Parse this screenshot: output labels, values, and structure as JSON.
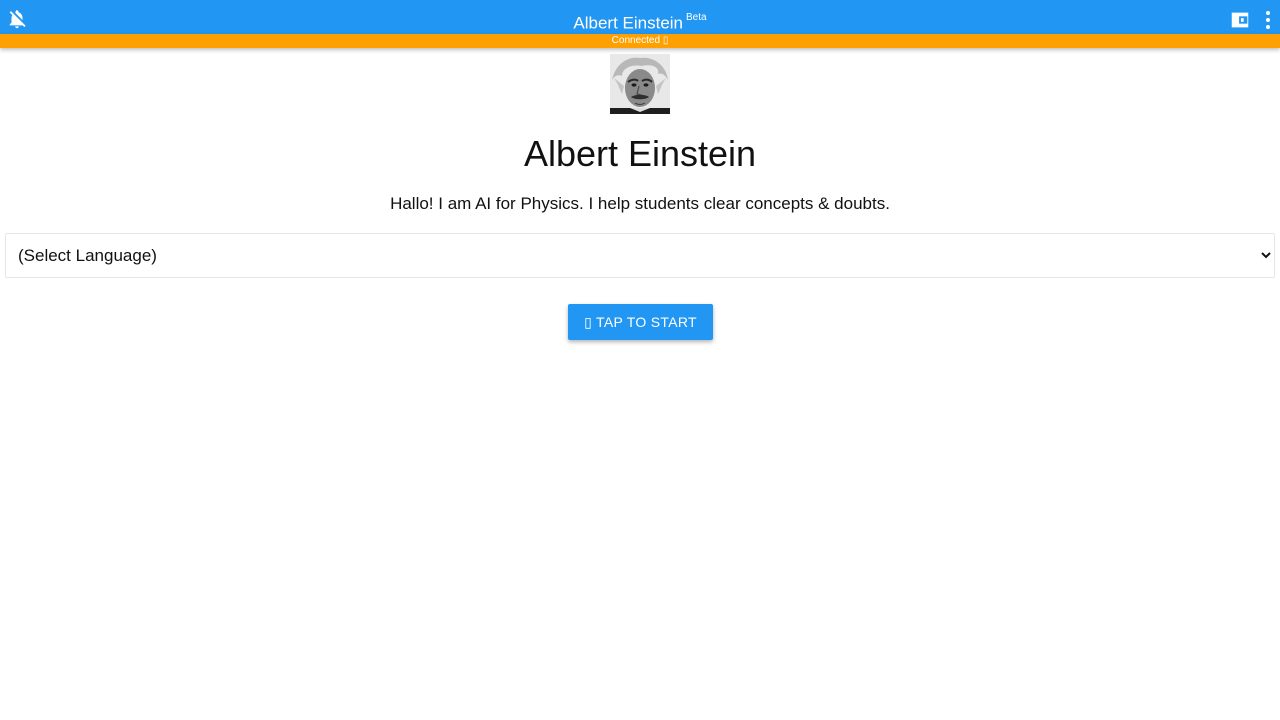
{
  "header": {
    "title": "Albert Einstein",
    "badge": "Beta",
    "icons": [
      "bell-off-icon",
      "wallet-icon",
      "more-vertical-icon"
    ],
    "background_color": "#2196f3"
  },
  "status": {
    "text": "Connected ▯",
    "background_color": "#ffa000"
  },
  "profile": {
    "name": "Albert Einstein",
    "intro": "Hallo! I am AI for Physics. I help students clear concepts & doubts."
  },
  "language_select": {
    "selected": "(Select Language)"
  },
  "start_button": {
    "label": "▯ TAP TO START",
    "background_color": "#2196f3"
  }
}
